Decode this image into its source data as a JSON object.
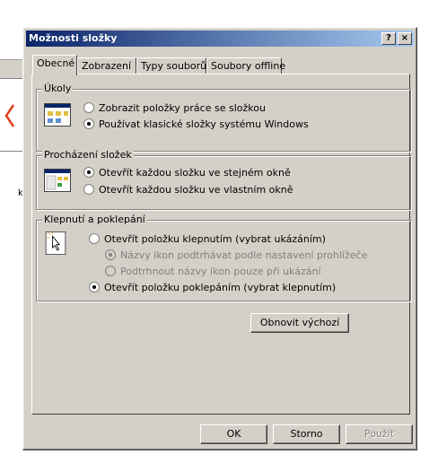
{
  "window": {
    "title": "Možnosti složky",
    "help_label": "?",
    "close_label": "×"
  },
  "tabs": [
    {
      "label": "Obecné",
      "active": true
    },
    {
      "label": "Zobrazení",
      "active": false
    },
    {
      "label": "Typy souborů",
      "active": false
    },
    {
      "label": "Soubory offline",
      "active": false
    }
  ],
  "groups": {
    "tasks": {
      "label": "Úkoly",
      "options": [
        {
          "label": "Zobrazit položky práce se složkou",
          "selected": false,
          "enabled": true
        },
        {
          "label": "Používat klasické složky systému Windows",
          "selected": true,
          "enabled": true
        }
      ]
    },
    "browse": {
      "label": "Procházení složek",
      "options": [
        {
          "label": "Otevřít každou složku ve stejném okně",
          "selected": true,
          "enabled": true
        },
        {
          "label": "Otevřít každou složku ve vlastním okně",
          "selected": false,
          "enabled": true
        }
      ]
    },
    "click": {
      "label": "Klepnutí a poklepání",
      "options": [
        {
          "label": "Otevřít položku klepnutím (vybrat ukázáním)",
          "selected": false,
          "enabled": true
        },
        {
          "label": "Názvy ikon podtrhávat podle nastavení prohlížeče",
          "selected": true,
          "enabled": false
        },
        {
          "label": "Podtrhnout názvy ikon pouze při ukázání",
          "selected": false,
          "enabled": false
        },
        {
          "label": "Otevřít položku poklepáním (vybrat klepnutím)",
          "selected": true,
          "enabled": true
        }
      ]
    }
  },
  "restore_defaults_label": "Obnovit výchozí",
  "footer": {
    "ok_label": "OK",
    "cancel_label": "Storno",
    "apply_label": "Použít"
  },
  "background": {
    "fragment_text": "k"
  },
  "colors": {
    "titlebar_start": "#0a246a",
    "titlebar_end": "#a6caf0",
    "face": "#d4d0c8",
    "background_arrow": "#e04020"
  }
}
